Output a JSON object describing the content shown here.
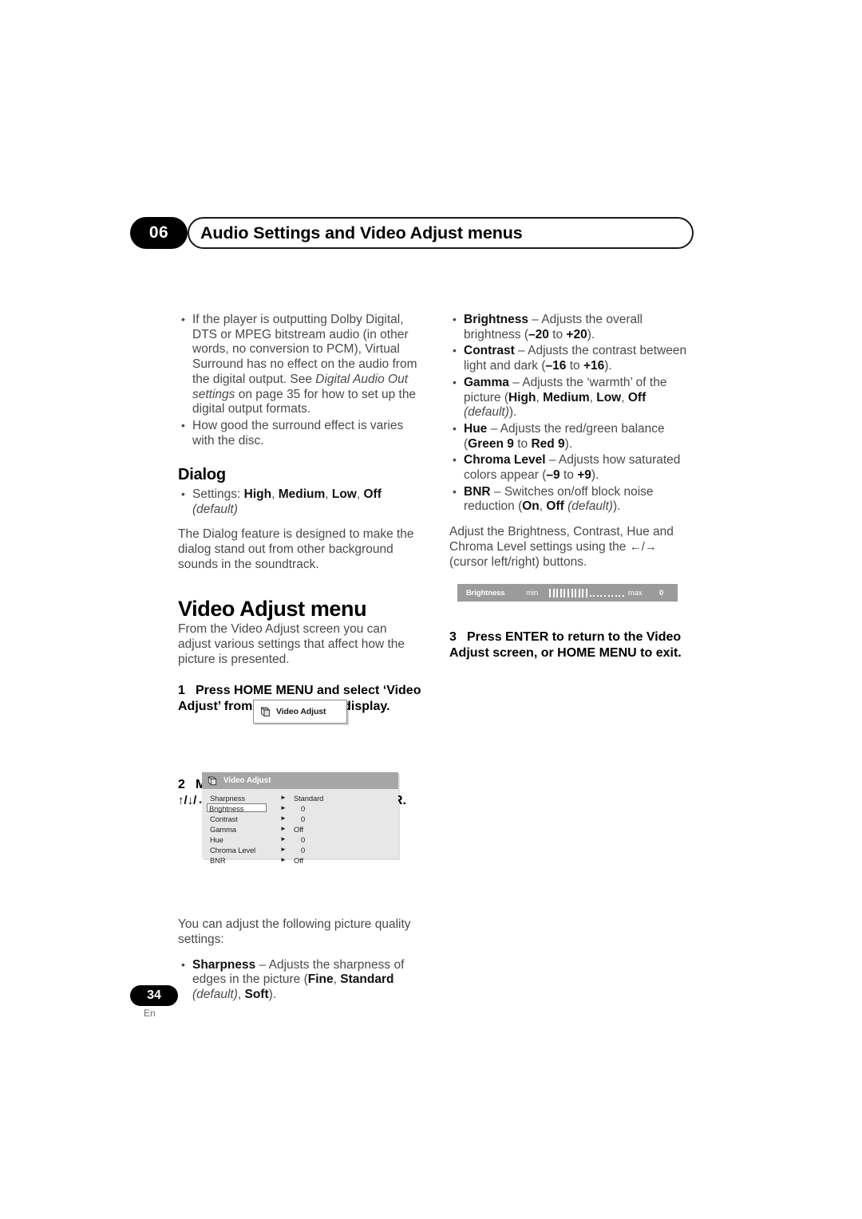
{
  "header": {
    "chapter_number": "06",
    "chapter_title": "Audio Settings and Video Adjust menus"
  },
  "left_column": {
    "intro_bullets": [
      "If the player is outputting Dolby Digital, DTS or MPEG bitstream audio (in other words, no conversion to PCM), Virtual Surround has no effect on the audio from the digital output. See Digital Audio Out settings on page 35 for how to set up the digital output formats.",
      "How good the surround effect is varies with the disc."
    ],
    "dialog_heading": "Dialog",
    "dialog_settings_bullet": "Settings: High, Medium, Low, Off (default)",
    "dialog_body": "The Dialog feature is designed to make the dialog stand out from other background sounds in the soundtrack.",
    "video_adjust_heading": "Video Adjust menu",
    "video_adjust_intro": "From the Video Adjust screen you can adjust various settings that affect how the picture is presented.",
    "step1_number": "1",
    "step1_text": "Press HOME MENU and select ‘Video Adjust’ from the on-screen display.",
    "step2_number": "2",
    "step2_text": "Make settings using the",
    "step2_arrows": "↑/↓/←/→",
    "step2_text2": "(cursor) buttons, and ENTER.",
    "settings_intro": "You can adjust the following picture quality settings:",
    "sharpness_bullet": "Sharpness – Adjusts the sharpness of edges in the picture (Fine, Standard (default), Soft)."
  },
  "osd_button": {
    "label": "Video Adjust",
    "icon": "disc-icon"
  },
  "osd_panel": {
    "title": "Video Adjust",
    "icon": "disc-icon",
    "rows": [
      {
        "name": "Sharpness",
        "arrow": "►",
        "value": "Standard",
        "selected": false
      },
      {
        "name": "Brightness",
        "arrow": "►",
        "value": "0",
        "selected": true
      },
      {
        "name": "Contrast",
        "arrow": "►",
        "value": "0",
        "selected": false
      },
      {
        "name": "Gamma",
        "arrow": "►",
        "value": "Off",
        "selected": false
      },
      {
        "name": "Hue",
        "arrow": "►",
        "value": "0",
        "selected": false
      },
      {
        "name": "Chroma Level",
        "arrow": "►",
        "value": "0",
        "selected": false
      },
      {
        "name": "BNR",
        "arrow": "►",
        "value": "Off",
        "selected": false
      }
    ]
  },
  "right_column": {
    "bullets": [
      "Brightness – Adjusts the overall brightness (–20 to +20).",
      "Contrast – Adjusts the contrast between light and dark (–16 to +16).",
      "Gamma – Adjusts the ‘warmth’ of the picture (High, Medium, Low, Off (default)).",
      "Hue – Adjusts the red/green balance (Green 9 to Red 9).",
      "Chroma Level – Adjusts how saturated colors appear (–9 to +9).",
      "BNR – Switches on/off block noise reduction (On, Off (default))."
    ],
    "adjust_note": "Adjust the Brightness, Contrast, Hue and Chroma Level settings using the ←/→ (cursor left/right) buttons.",
    "step3_number": "3",
    "step3_text": "Press ENTER to return to the Video Adjust screen, or HOME MENU to exit."
  },
  "slider_graphic": {
    "label": "Brightness",
    "min_label": "min",
    "max_label": "max",
    "value": "0",
    "filled_ticks": 11,
    "empty_dots": 10
  },
  "footer": {
    "page_number": "34",
    "language": "En"
  },
  "colors": {
    "text": "#4a4a4a",
    "heading": "#000000",
    "osd_titlebar": "#a6a6a6",
    "osd_body": "#e7e7e7",
    "slider_bg": "#9b9b9b"
  }
}
